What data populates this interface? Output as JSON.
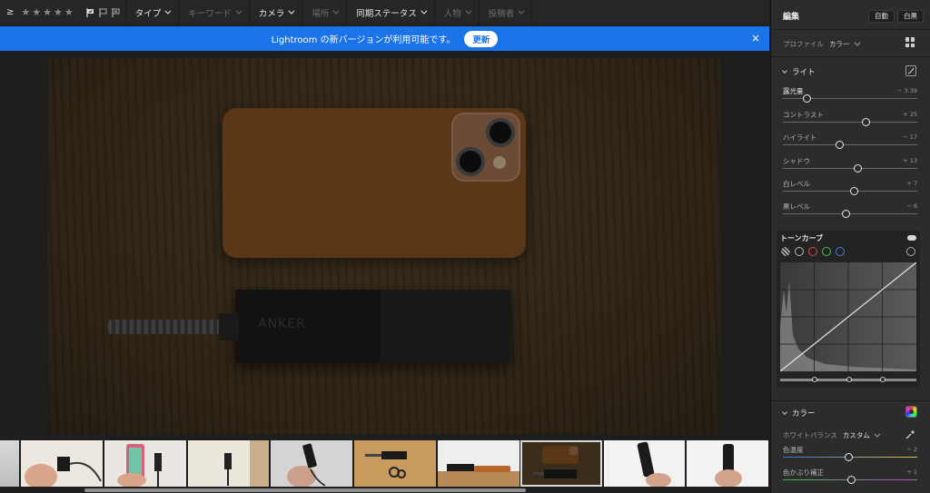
{
  "topbar": {
    "sort_glyph": "≥",
    "stars": "★★★★★",
    "filters": [
      {
        "label": "タイプ",
        "active": true
      },
      {
        "label": "キーワード",
        "active": false
      },
      {
        "label": "カメラ",
        "active": true
      },
      {
        "label": "場所",
        "active": false
      },
      {
        "label": "同期ステータス",
        "active": true
      },
      {
        "label": "人物",
        "active": false
      },
      {
        "label": "投稿者",
        "active": false
      }
    ]
  },
  "banner": {
    "message": "Lightroom の新バージョンが利用可能です。",
    "update_label": "更新",
    "close_glyph": "×",
    "color": "#1a73e8"
  },
  "photo": {
    "product_text": "ANKER"
  },
  "filmstrip": {
    "selected_index": 6,
    "thumbs": [
      {
        "name": "thumb-hand-charger"
      },
      {
        "name": "thumb-phone-in-hand"
      },
      {
        "name": "thumb-cable-on-wall"
      },
      {
        "name": "thumb-hand-black-device"
      },
      {
        "name": "thumb-hub-on-desk"
      },
      {
        "name": "thumb-hub-and-case"
      },
      {
        "name": "thumb-phone-and-hub-selected"
      },
      {
        "name": "thumb-black-device-white"
      },
      {
        "name": "thumb-black-device-hand-white"
      }
    ]
  },
  "panel": {
    "title": "編集",
    "auto_label": "自動",
    "bw_label": "白黒",
    "profile_label": "プロファイル",
    "profile_value": "カラー",
    "light_section": "ライト",
    "sliders": [
      {
        "label": "露光量",
        "value": "− 3.39",
        "pos": 0.18,
        "strong": true
      },
      {
        "label": "コントラスト",
        "value": "+ 25",
        "pos": 0.62,
        "strong": false
      },
      {
        "label": "ハイライト",
        "value": "− 17",
        "pos": 0.42,
        "strong": false
      },
      {
        "label": "シャドウ",
        "value": "+ 13",
        "pos": 0.56,
        "strong": false
      },
      {
        "label": "白レベル",
        "value": "+ 7",
        "pos": 0.53,
        "strong": false
      },
      {
        "label": "黒レベル",
        "value": "− 6",
        "pos": 0.47,
        "strong": false
      }
    ],
    "tone_curve": {
      "title": "トーンカーブ",
      "channel_colors": [
        "#bbbbbb",
        "#e04545",
        "#3cbf4a",
        "#4a7be0"
      ]
    },
    "color_section": "カラー",
    "wb_label": "ホワイトバランス",
    "wb_value": "カスタム",
    "temp": {
      "label": "色温度",
      "value": "− 2",
      "pos": 0.49
    },
    "tint": {
      "label": "色かぶり補正",
      "value": "+ 1",
      "pos": 0.51
    }
  }
}
